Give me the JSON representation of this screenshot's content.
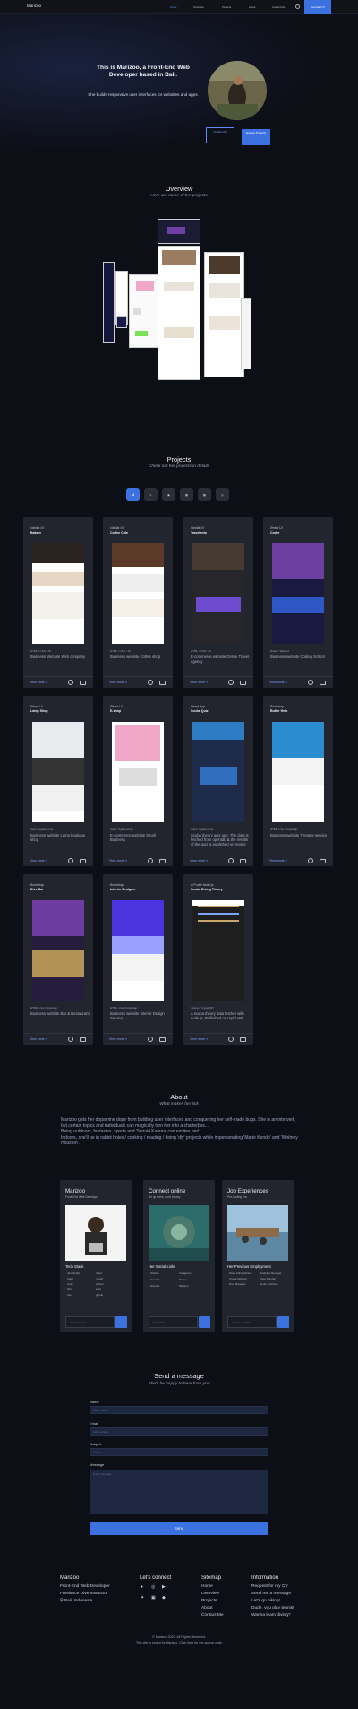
{
  "nav": {
    "brand": "Marizoo",
    "links": [
      "Home",
      "Overview",
      "Projects",
      "About",
      "Contact Me"
    ],
    "cta": "Download CV"
  },
  "hero": {
    "title": "This is Marizoo, a Front-End Web Developer based in Bali.",
    "subtitle": "She builds responsive user interfaces for websites and apps.",
    "btn_contact": "Contact Me",
    "btn_projects": "Explore Projects"
  },
  "overview": {
    "title": "Overview",
    "subtitle": "Here are some of her projects"
  },
  "projects": {
    "title": "Projects",
    "subtitle": "Check out her projects in details",
    "filters": [
      "All",
      "react",
      "next",
      "html",
      "js",
      "api"
    ],
    "view_more": "View more",
    "items": [
      {
        "tech": "Vanilla UI",
        "name": "Bakery",
        "stack": "HTML / CSS / JS",
        "desc": "Business Website Web company",
        "thumb": "light"
      },
      {
        "tech": "Vanilla UI",
        "name": "Coffee Cafe",
        "stack": "HTML / CSS / JS",
        "desc": "Business website Coffee shop",
        "thumb": "light2"
      },
      {
        "tech": "Vanilla UI",
        "name": "Travelento",
        "stack": "HTML / CSS / JS",
        "desc": "E-commerce website Online Travel agency",
        "thumb": "dark"
      },
      {
        "tech": "React UI",
        "name": "Coder",
        "stack": "React / Tailwind",
        "desc": "Business website Coding School",
        "thumb": "darkblue"
      },
      {
        "tech": "React UI",
        "name": "Lamp Shop",
        "stack": "react / styled-comp",
        "desc": "Business website Lamp boutique shop",
        "thumb": "light3"
      },
      {
        "tech": "React UI",
        "name": "E-shop",
        "stack": "react / styled-comp",
        "desc": "E-commerce website Small Business",
        "thumb": "white"
      },
      {
        "tech": "React App",
        "name": "Scuba Quiz",
        "stack": "react / styled-comp",
        "desc": "Scuba theory quiz app. The data is fetched from opentdb & the results of the quiz is published on mysite",
        "thumb": "quiz"
      },
      {
        "tech": "Bootstrap",
        "name": "Butter Help",
        "stack": "HTML / css / bootstrap",
        "desc": "Business website Therapy service",
        "thumb": "light4"
      },
      {
        "tech": "Bootstrap",
        "name": "Dive Bar",
        "stack": "HTML / css / bootstrap",
        "desc": "Business website Bar & Restaurant",
        "thumb": "purple"
      },
      {
        "tech": "Bootstrap",
        "name": "Interior Designer",
        "stack": "HTML / css / bootstrap",
        "desc": "Business website Interior Design Service",
        "thumb": "blue"
      },
      {
        "tech": "API with Node.js",
        "name": "Scuba Diving Theory",
        "stack": "node.js / mysql API",
        "desc": "A scuba theory data fetcher with node.js, Published on rapid API",
        "thumb": "code"
      }
    ]
  },
  "about": {
    "title": "About",
    "subtitle": "What makes her tick",
    "p1": "Marizoo gets her dopamine dope from building user interfaces and conquering her self-made bugs. She is an introvert, but certain topics and individuals can magically turn her into a chatterbox...",
    "p2": "Being outdoors, fantasies, sports and 'Suzuki Katana' can excites her!",
    "p3": "Indoors, she'll be in rabbit holes / cooking / reading / doing 'diy' projects while impersonating 'Marie Kondo' and 'Whitney Houston'.",
    "cards": [
      {
        "title": "Marizoo",
        "sub": "Front-End Web Developer",
        "list_title": "Tech Stack",
        "items": [
          "JavaScript",
          "react",
          "node",
          "html",
          "css",
          "redux",
          "mysql",
          "python",
          "sass",
          "github"
        ],
        "placeholder": "View Projects"
      },
      {
        "title": "Connect online",
        "sub": "Be up there, don't be shy",
        "list_title": "Her Social Links",
        "items": [
          "GitHub",
          "Instagram",
          "Youtube",
          "Twitter",
          "Discord",
          "Medium"
        ],
        "placeholder": "Say hello!"
      },
      {
        "title": "Job Experiences",
        "sub": "Pre-Coding era",
        "list_title": "Her Previous Employment",
        "items": [
          "Store Administrator",
          "Justicafe Manager",
          "Cruise Director",
          "Yoga Teacher",
          "Dive Manager",
          "Junior Architect"
        ],
        "placeholder": "Add me on CM"
      }
    ]
  },
  "contact": {
    "title": "Send a message",
    "subtitle": "She'll be happy to hear from you",
    "name_label": "Name",
    "name_ph": "Enter name...",
    "email_label": "Email",
    "email_ph": "Enter email...",
    "subject_label": "Subject",
    "subject_ph": "Subject",
    "message_label": "Message",
    "message_ph": "Enter message...",
    "send": "Send"
  },
  "footer": {
    "about_title": "Marizoo",
    "about_items": [
      "Front-End Web Developer",
      "Freelance Dive Instructor",
      "Bali, Indonesia"
    ],
    "connect_title": "Let's connect",
    "sitemap_title": "Sitemap",
    "sitemap_items": [
      "Home",
      "Overview",
      "Projects",
      "About",
      "Contact Me"
    ],
    "info_title": "Information",
    "info_items": [
      "Request for my CV",
      "Send me a message",
      "Let's go hiking!",
      "Dude, you play tennis!",
      "Wanna learn diving?"
    ],
    "copyright": "© Marizoo 2023. All Rights Reserved.",
    "credit": "This site is coded by Marizoo. Click here for the source code"
  },
  "colors": {
    "bg": "#0d0f17",
    "card": "#22252e",
    "accent": "#3c72e0"
  }
}
